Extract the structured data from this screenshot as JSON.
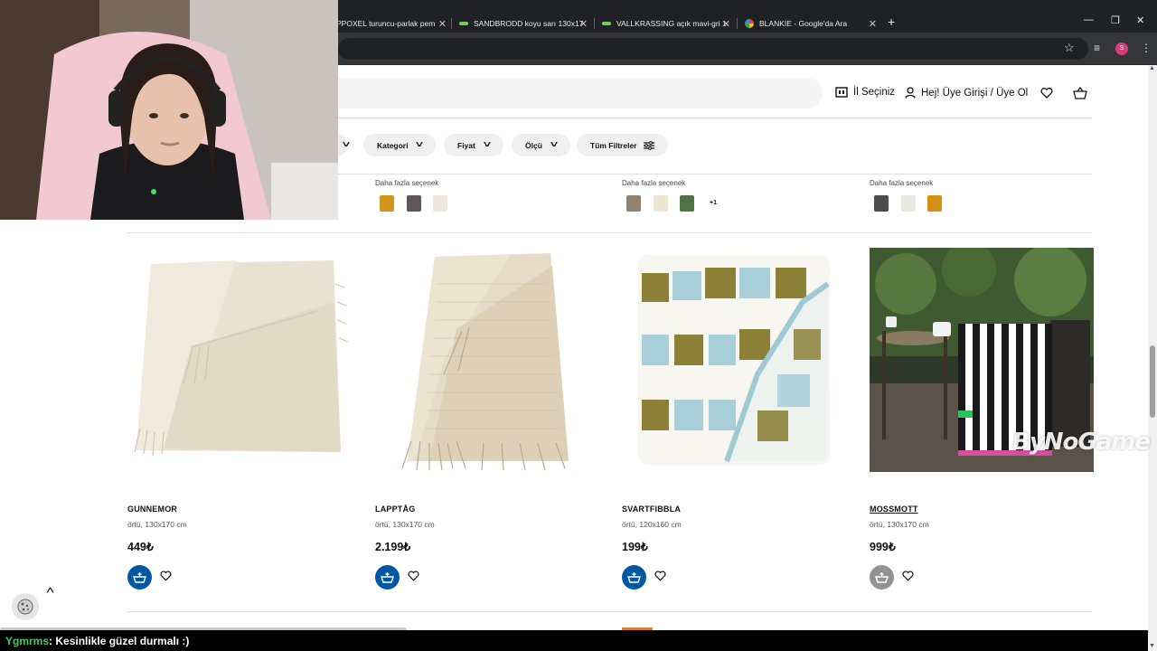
{
  "browser": {
    "tabs": [
      {
        "title": "PPOXEL turuncu-parlak pem",
        "favicon": "green-bar-icon"
      },
      {
        "title": "SANDBRODD koyu sarı 130x17",
        "favicon": "green-bar-icon"
      },
      {
        "title": "VALLKRASSING açık mavi-gri 1",
        "favicon": "green-bar-icon"
      },
      {
        "title": "BLANKIE - Google'da Ara",
        "favicon": "google-icon"
      }
    ],
    "new_tab": "+",
    "profile_initial": "S"
  },
  "header": {
    "store_select": "İl Seçiniz",
    "login": "Hej! Üye Girişi / Üye Ol"
  },
  "filters": [
    {
      "label": "Kategori"
    },
    {
      "label": "Fiyat"
    },
    {
      "label": "Ölçü"
    },
    {
      "label": "Tüm Filtreler"
    }
  ],
  "prev_row": {
    "more_options_label": "Daha fazla seçenek",
    "groups": [
      {
        "swatches": [
          "#d4951c",
          "#5e5858",
          "#ece8de"
        ],
        "extra": ""
      },
      {
        "swatches": [
          "#8f8474",
          "#ede6d2",
          "#4f7448"
        ],
        "extra": "+1"
      },
      {
        "swatches": [
          "#4e4a48",
          "#ebe8e1",
          "#d58f12"
        ],
        "extra": ""
      }
    ]
  },
  "products": [
    {
      "name": "GUNNEMOR",
      "desc": "örtü, 130x170 cm",
      "price": "449₺"
    },
    {
      "name": "LAPPTÅG",
      "desc": "örtü, 130x170 cm",
      "price": "2.199₺"
    },
    {
      "name": "SVARTFIBBLA",
      "desc": "örtü, 120x160 cm",
      "price": "199₺"
    },
    {
      "name": "MOSSMOTT",
      "desc": "örtü, 130x170 cm",
      "price": "999₺"
    }
  ],
  "overlay": {
    "chat_user": "Ygmrms",
    "chat_message": " : Kesinlikle güzel durmalı :)",
    "watermark": "ByNoGame"
  },
  "colors": {
    "ikea_blue": "#0058a3",
    "chat_user": "#3ecf5a",
    "browser_dark": "#202124"
  }
}
